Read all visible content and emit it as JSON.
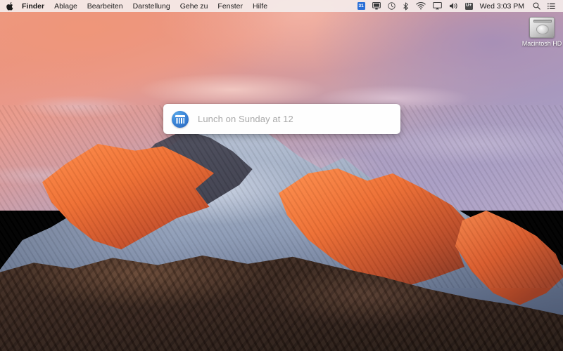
{
  "menubar": {
    "apple_logo": "",
    "app_items": [
      {
        "label": "Finder",
        "bold": true,
        "name": "menu-finder"
      },
      {
        "label": "Ablage",
        "bold": false,
        "name": "menu-ablage"
      },
      {
        "label": "Bearbeiten",
        "bold": false,
        "name": "menu-bearbeiten"
      },
      {
        "label": "Darstellung",
        "bold": false,
        "name": "menu-darstellung"
      },
      {
        "label": "Gehe zu",
        "bold": false,
        "name": "menu-gehe-zu"
      },
      {
        "label": "Fenster",
        "bold": false,
        "name": "menu-fenster"
      },
      {
        "label": "Hilfe",
        "bold": false,
        "name": "menu-hilfe"
      }
    ],
    "status": {
      "calendar_badge": "31",
      "unicode_badge": "U+",
      "clock": "Wed 3:03 PM"
    },
    "background_color": "#f4ebea",
    "text_color": "#1a1a1a"
  },
  "desktop": {
    "hard_drive_label": "Macintosh HD"
  },
  "dialog": {
    "text": "Lunch on Sunday at 12",
    "icon_color": "#3b86d8",
    "background_color": "#fefefe"
  }
}
